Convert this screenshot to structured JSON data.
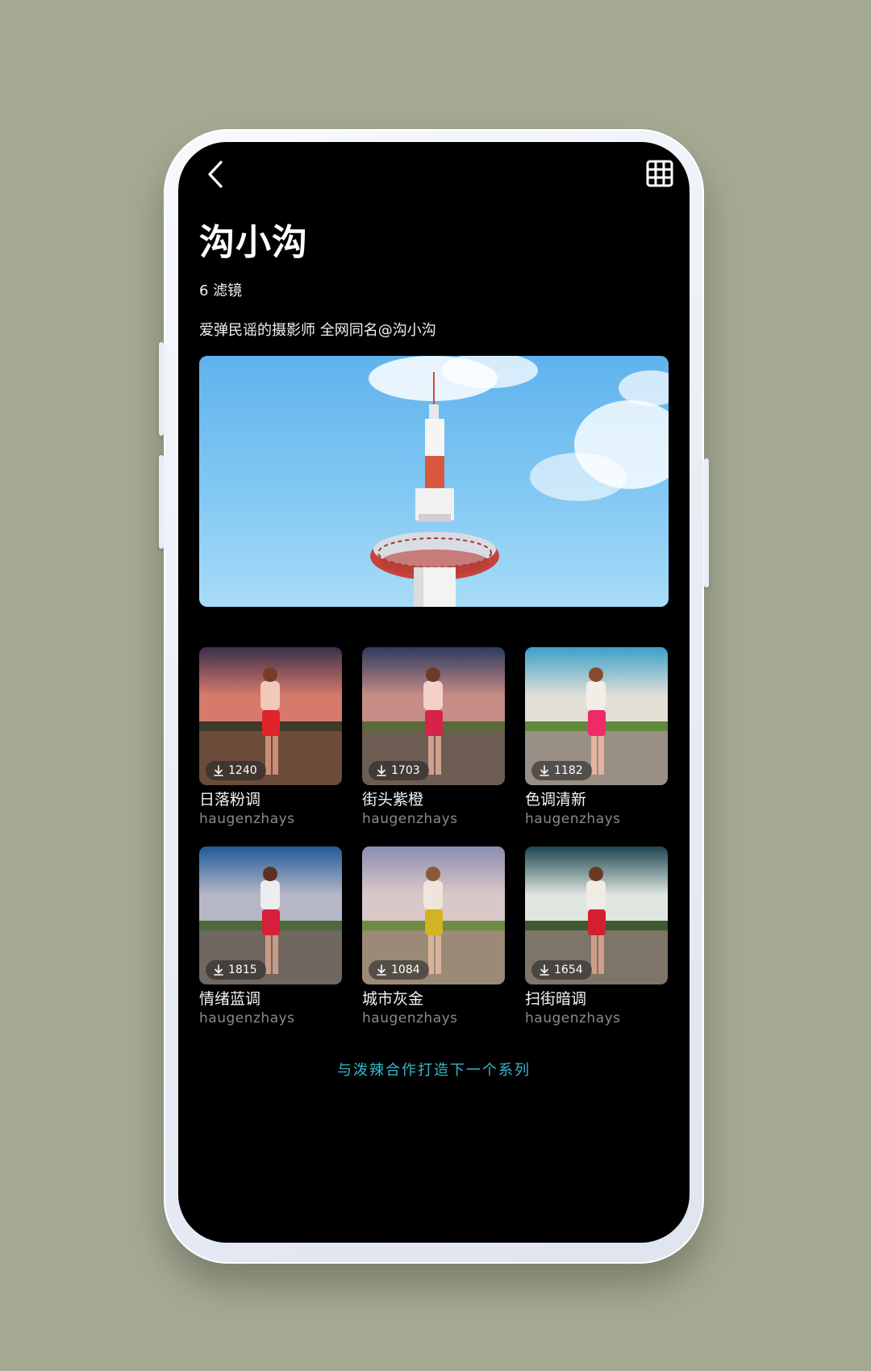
{
  "header": {
    "title": "沟小沟",
    "filter_count": "6 滤镜",
    "bio": "爱弹民谣的摄影师 全网同名@沟小沟"
  },
  "filters": [
    {
      "name": "日落粉调",
      "author": "haugenzhays",
      "downloads": "1240",
      "tones": {
        "top": "#3a2f4a",
        "mid": "#d77a6c",
        "ground": "#6b4b3a",
        "skirt": "#e0242a",
        "shirt": "#f0c9b8"
      }
    },
    {
      "name": "街头紫橙",
      "author": "haugenzhays",
      "downloads": "1703",
      "tones": {
        "top": "#2c3a5e",
        "mid": "#c68c86",
        "ground": "#6d5d53",
        "skirt": "#d4244a",
        "shirt": "#f3cfc6"
      }
    },
    {
      "name": "色调清新",
      "author": "haugenzhays",
      "downloads": "1182",
      "tones": {
        "top": "#3aa0c8",
        "mid": "#e2dfd6",
        "ground": "#9a8f85",
        "skirt": "#ef2a6a",
        "shirt": "#f4ece6"
      }
    },
    {
      "name": "情绪蓝调",
      "author": "haugenzhays",
      "downloads": "1815",
      "tones": {
        "top": "#1f5a98",
        "mid": "#b6b7c6",
        "ground": "#6f6760",
        "skirt": "#d81e3a",
        "shirt": "#ededf0"
      }
    },
    {
      "name": "城市灰金",
      "author": "haugenzhays",
      "downloads": "1084",
      "tones": {
        "top": "#8b8db2",
        "mid": "#d9c8c8",
        "ground": "#9b8b76",
        "skirt": "#d2b320",
        "shirt": "#efe6d9"
      }
    },
    {
      "name": "扫街暗调",
      "author": "haugenzhays",
      "downloads": "1654",
      "tones": {
        "top": "#1c4552",
        "mid": "#dfe6e0",
        "ground": "#7e7468",
        "skirt": "#d4202e",
        "shirt": "#f0ece6"
      }
    }
  ],
  "footer": {
    "collab_link": "与泼辣合作打造下一个系列"
  },
  "icons": {
    "back": "chevron-left-icon",
    "grid": "grid-icon",
    "download": "download-icon"
  },
  "colors": {
    "accent": "#38b8cc",
    "background": "#000000",
    "outer_background": "#a5aa94"
  }
}
